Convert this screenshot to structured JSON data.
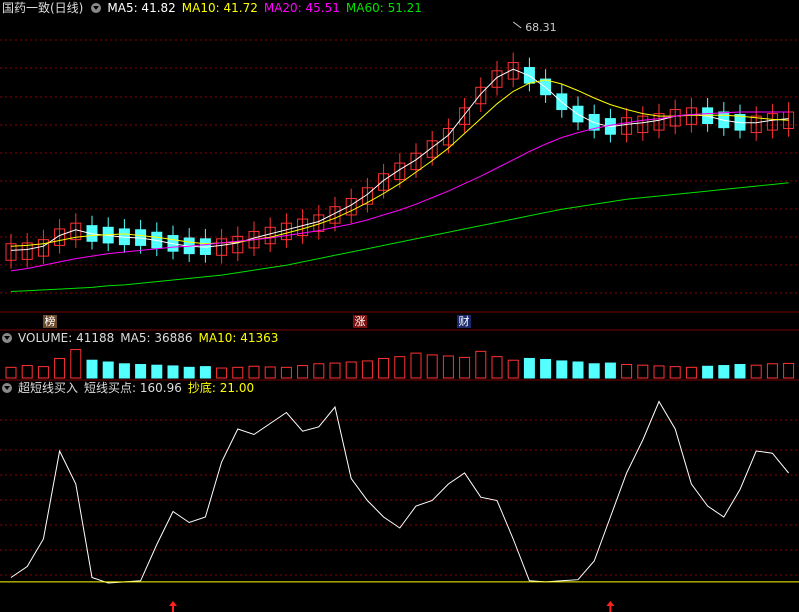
{
  "price_panel": {
    "title": "国药一致(日线)",
    "ma5": "MA5: 41.82",
    "ma10": "MA10: 41.72",
    "ma20": "MA20: 45.51",
    "ma60": "MA60: 51.21",
    "high_label": "68.31",
    "event_tags": [
      "榜",
      "涨",
      "财"
    ]
  },
  "volume_panel": {
    "vol": "VOLUME: 41188",
    "ma5": "MA5: 36886",
    "ma10": "MA10: 41363"
  },
  "indicator_panel": {
    "name": "超短线买入",
    "buy_point": "短线买点: 160.96",
    "bottom": "抄底: 21.00"
  },
  "colors": {
    "up": "#ff3232",
    "down": "#54ffff",
    "ma5": "#ffffff",
    "ma10": "#ffff00",
    "ma20": "#ff00ff",
    "ma60": "#00e000",
    "grid": "#8b0000",
    "title_ma10": "#ffff00"
  },
  "chart_data": [
    {
      "type": "candlestick",
      "series": [
        {
          "name": "MA5",
          "values": [
            43.0,
            43.1,
            43.5,
            44.8,
            45.5,
            45.0,
            44.8,
            44.6,
            44.5,
            44.2,
            43.8,
            43.5,
            43.4,
            43.6,
            43.9,
            44.5,
            45.0,
            45.5,
            46.0,
            46.5,
            47.5,
            48.5,
            49.8,
            51.5,
            52.8,
            54.0,
            55.5,
            57.0,
            59.5,
            62.0,
            64.0,
            65.0,
            64.2,
            62.8,
            61.0,
            59.5,
            58.5,
            58.0,
            58.3,
            58.5,
            58.8,
            59.3,
            59.5,
            59.3,
            58.8,
            58.5,
            58.5,
            58.8,
            59.0
          ]
        },
        {
          "name": "MA10",
          "values": [
            43.5,
            43.6,
            43.8,
            44.2,
            44.6,
            44.8,
            44.9,
            45.0,
            44.8,
            44.6,
            44.3,
            44.0,
            43.8,
            43.9,
            44.0,
            44.3,
            44.6,
            45.1,
            45.6,
            46.2,
            46.9,
            47.8,
            48.8,
            49.9,
            51.1,
            52.5,
            53.9,
            55.4,
            57.2,
            59.0,
            60.8,
            62.3,
            63.3,
            63.7,
            63.2,
            62.4,
            61.5,
            60.7,
            60.1,
            59.6,
            59.3,
            59.3,
            59.4,
            59.4,
            59.4,
            59.3,
            59.1,
            58.9,
            58.8
          ]
        },
        {
          "name": "MA20",
          "values": [
            40.5,
            40.8,
            41.2,
            41.6,
            42.0,
            42.3,
            42.6,
            42.8,
            43.0,
            43.2,
            43.4,
            43.5,
            43.7,
            43.9,
            44.1,
            44.3,
            44.5,
            44.8,
            45.1,
            45.4,
            45.8,
            46.2,
            46.7,
            47.3,
            47.9,
            48.6,
            49.4,
            50.2,
            51.1,
            52.0,
            53.0,
            54.0,
            55.0,
            55.9,
            56.7,
            57.3,
            57.8,
            58.2,
            58.5,
            58.8,
            59.0,
            59.3,
            59.5,
            59.6,
            59.7,
            59.8,
            59.8,
            59.8,
            59.8
          ]
        },
        {
          "name": "MA60",
          "values": [
            38.0,
            38.1,
            38.2,
            38.3,
            38.4,
            38.5,
            38.7,
            38.8,
            39.0,
            39.2,
            39.4,
            39.6,
            39.8,
            40.0,
            40.3,
            40.6,
            40.9,
            41.2,
            41.6,
            42.0,
            42.4,
            42.8,
            43.2,
            43.6,
            44.0,
            44.4,
            44.8,
            45.2,
            45.6,
            46.0,
            46.4,
            46.8,
            47.2,
            47.6,
            48.0,
            48.3,
            48.6,
            48.9,
            49.2,
            49.4,
            49.6,
            49.8,
            50.0,
            50.2,
            50.4,
            50.6,
            50.8,
            51.0,
            51.2
          ]
        }
      ],
      "annotations": [
        "68.31"
      ]
    },
    {
      "type": "bar",
      "series": [
        {
          "name": "VOLUME",
          "values": [
            30,
            35,
            32,
            55,
            80,
            50,
            45,
            40,
            38,
            36,
            34,
            30,
            32,
            28,
            30,
            33,
            31,
            30,
            35,
            40,
            42,
            45,
            48,
            55,
            60,
            70,
            65,
            62,
            58,
            75,
            60,
            50,
            55,
            52,
            48,
            45,
            40,
            42,
            38,
            36,
            34,
            32,
            30,
            33,
            35,
            38,
            36,
            40,
            41
          ]
        }
      ]
    },
    {
      "type": "line",
      "series": [
        {
          "name": "超短线买入",
          "values": [
            25,
            35,
            60,
            140,
            110,
            25,
            20,
            21,
            22,
            55,
            85,
            75,
            80,
            130,
            160,
            155,
            165,
            175,
            158,
            162,
            180,
            115,
            95,
            80,
            70,
            90,
            95,
            110,
            120,
            98,
            95,
            60,
            22,
            21,
            22,
            23,
            40,
            80,
            120,
            150,
            185,
            160,
            110,
            90,
            80,
            105,
            140,
            138,
            120
          ]
        }
      ],
      "annotations": [
        "抄底: 21.00"
      ]
    }
  ]
}
